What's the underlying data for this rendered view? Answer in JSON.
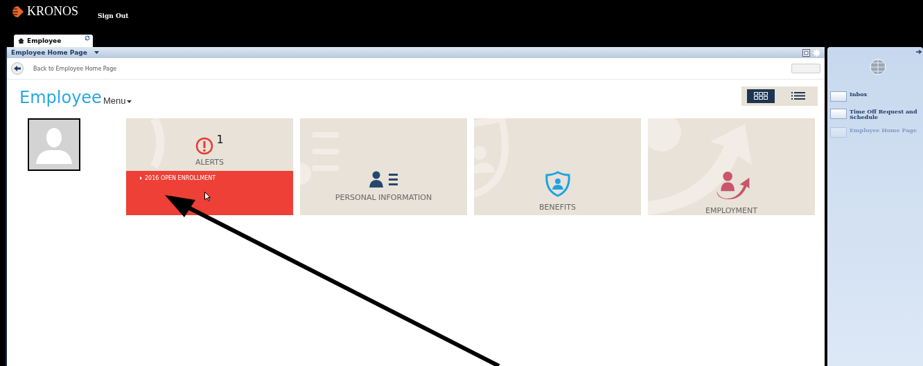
{
  "header": {
    "logo": "KRONOS",
    "sign_out": "Sign Out"
  },
  "tabs": [
    {
      "label": "Employee",
      "selected": true
    }
  ],
  "window": {
    "title": "Employee Home Page"
  },
  "back_link": "Back to Employee Home Page",
  "heading": {
    "title": "Employee",
    "menu": "Menu"
  },
  "view_toggle": [
    {
      "kind": "grid",
      "selected": true
    },
    {
      "kind": "list",
      "selected": false
    }
  ],
  "tiles": [
    {
      "kind": "alerts",
      "label": "ALERTS",
      "count": "1",
      "alert_items": [
        "2016 OPEN ENROLLMENT"
      ]
    },
    {
      "kind": "personal",
      "label": "PERSONAL INFORMATION"
    },
    {
      "kind": "benefits",
      "label": "BENEFITS"
    },
    {
      "kind": "employment",
      "label": "EMPLOYMENT"
    }
  ],
  "sidebar": {
    "items": [
      {
        "label": "Inbox",
        "disabled": false
      },
      {
        "label": "Time Off Request and Schedule",
        "disabled": false
      },
      {
        "label": "Employee Home Page",
        "disabled": true
      }
    ]
  }
}
